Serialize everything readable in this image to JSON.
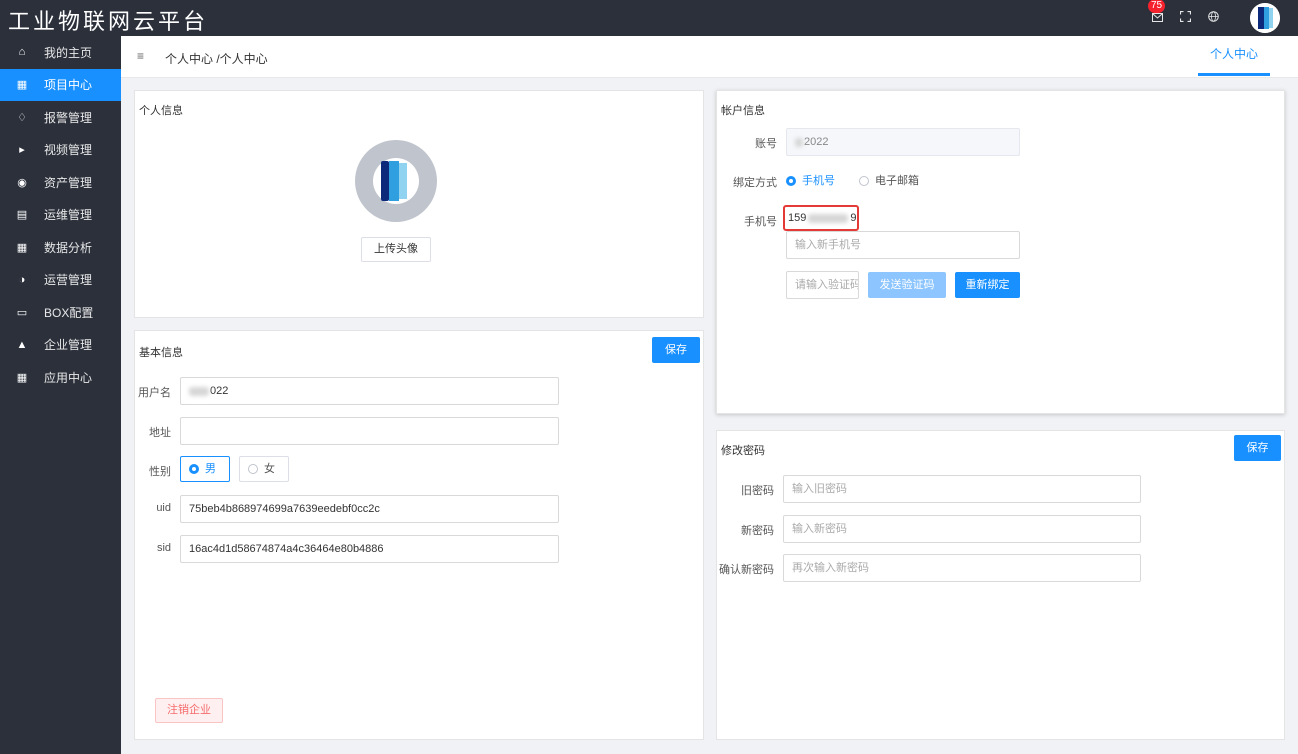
{
  "app": {
    "title": "工业物联网云平台",
    "notification_count": "75"
  },
  "topbar": {
    "icons": [
      "mail-icon",
      "fullscreen-icon",
      "globe-icon",
      "avatar"
    ]
  },
  "sidebar": {
    "items": [
      {
        "label": "我的主页",
        "icon": "home-icon",
        "active": false
      },
      {
        "label": "项目中心",
        "icon": "grid-icon",
        "active": true
      },
      {
        "label": "报警管理",
        "icon": "bell-icon",
        "active": false
      },
      {
        "label": "视频管理",
        "icon": "video-icon",
        "active": false
      },
      {
        "label": "资产管理",
        "icon": "camera-icon",
        "active": false
      },
      {
        "label": "运维管理",
        "icon": "document-icon",
        "active": false
      },
      {
        "label": "数据分析",
        "icon": "grid-icon",
        "active": false
      },
      {
        "label": "运营管理",
        "icon": "pie-icon",
        "active": false
      },
      {
        "label": "BOX配置",
        "icon": "monitor-icon",
        "active": false
      },
      {
        "label": "企业管理",
        "icon": "org-icon",
        "active": false
      },
      {
        "label": "应用中心",
        "icon": "grid-icon",
        "active": false
      }
    ]
  },
  "header": {
    "breadcrumb": "个人中心 /个人中心",
    "active_tab": "个人中心"
  },
  "personal_info": {
    "title": "个人信息",
    "upload_label": "上传头像"
  },
  "basic_info": {
    "title": "基本信息",
    "save_label": "保存",
    "username_label": "用户名",
    "username_value": "022",
    "address_label": "地址",
    "address_value": "",
    "gender_label": "性别",
    "gender_male": "男",
    "gender_female": "女",
    "uid_label": "uid",
    "uid_value": "75beb4b868974699a7639eedebf0cc2c",
    "sid_label": "sid",
    "sid_value": "16ac4d1d58674874a4c36464e80b4886",
    "cancel_enterprise_label": "注销企业"
  },
  "account_info": {
    "title": "帐户信息",
    "account_label": "账号",
    "account_value": "2022",
    "binding_label": "绑定方式",
    "binding_phone": "手机号",
    "binding_email": "电子邮箱",
    "phone_label": "手机号",
    "phone_prefix": "159",
    "phone_suffix": "9",
    "new_phone_placeholder": "输入新手机号",
    "code_placeholder": "请输入验证码",
    "send_code_label": "发送验证码",
    "rebind_label": "重新绑定"
  },
  "change_password": {
    "title": "修改密码",
    "save_label": "保存",
    "old_label": "旧密码",
    "old_placeholder": "输入旧密码",
    "new_label": "新密码",
    "new_placeholder": "输入新密码",
    "confirm_label": "确认新密码",
    "confirm_placeholder": "再次输入新密码"
  },
  "colors": {
    "primary": "#1890ff",
    "sidebar_bg": "#2b303b",
    "danger": "#f56c6c",
    "highlight_box": "#e53935"
  }
}
